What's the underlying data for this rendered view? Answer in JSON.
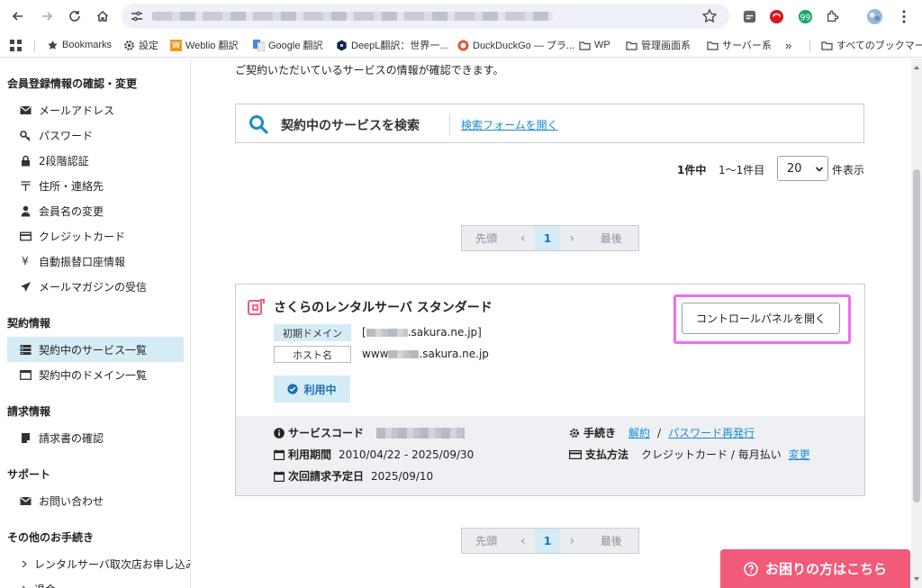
{
  "browser": {
    "back_icon": "back-arrow-icon",
    "bookmarks": [
      {
        "label": "Bookmarks",
        "icon": "star-icon"
      },
      {
        "label": "設定",
        "icon": "gear-icon"
      },
      {
        "label": "Weblio 翻訳",
        "icon": "weblio-icon"
      },
      {
        "label": "Google 翻訳",
        "icon": "google-translate-icon"
      },
      {
        "label": "DeepL翻訳：世界一...",
        "icon": "deepl-icon"
      },
      {
        "label": "DuckDuckGo — プラ...",
        "icon": "duckduckgo-icon"
      },
      {
        "label": "WP",
        "icon": "folder-icon"
      },
      {
        "label": "管理画面系",
        "icon": "folder-icon"
      },
      {
        "label": "サーバー系",
        "icon": "folder-icon"
      },
      {
        "label": "»",
        "icon": "more-icon"
      },
      {
        "label": "すべてのブックマーク",
        "icon": "folder-icon"
      }
    ]
  },
  "sidebar": {
    "sections": [
      {
        "heading": "会員登録情報の確認・変更",
        "items": [
          {
            "label": "メールアドレス",
            "icon": "envelope-icon"
          },
          {
            "label": "パスワード",
            "icon": "key-icon"
          },
          {
            "label": "2段階認証",
            "icon": "lock-icon"
          },
          {
            "label": "住所・連絡先",
            "icon": "postal-mark-icon"
          },
          {
            "label": "会員名の変更",
            "icon": "user-icon"
          },
          {
            "label": "クレジットカード",
            "icon": "credit-card-icon"
          },
          {
            "label": "自動振替口座情報",
            "icon": "yen-icon"
          },
          {
            "label": "メールマガジンの受信",
            "icon": "paper-plane-icon"
          }
        ]
      },
      {
        "heading": "契約情報",
        "items": [
          {
            "label": "契約中のサービス一覧",
            "icon": "server-list-icon",
            "active": true
          },
          {
            "label": "契約中のドメイン一覧",
            "icon": "window-icon"
          }
        ]
      },
      {
        "heading": "請求情報",
        "items": [
          {
            "label": "請求書の確認",
            "icon": "invoice-icon"
          }
        ]
      },
      {
        "heading": "サポート",
        "items": [
          {
            "label": "お問い合わせ",
            "icon": "envelope-icon"
          }
        ]
      },
      {
        "heading": "その他のお手続き",
        "items": [
          {
            "label": "レンタルサーバ取次店お申し込み",
            "icon": "chevron-right-icon"
          },
          {
            "label": "退会",
            "icon": "chevron-right-icon"
          }
        ]
      }
    ]
  },
  "main": {
    "intro": "ご契約いただいているサービスの情報が確認できます。",
    "search": {
      "title": "契約中のサービスを検索",
      "open_link": "検索フォームを開く"
    },
    "results": {
      "total": "1件中",
      "range": "1〜1件目",
      "per_page": "20",
      "per_page_suffix": "件表示"
    },
    "pager": {
      "first": "先頭",
      "prev": "‹",
      "current": "1",
      "next": "›",
      "last": "最後"
    },
    "service": {
      "name": "さくらのレンタルサーバ スタンダード",
      "initial_domain_label": "初期ドメイン",
      "initial_domain_prefix": "[",
      "initial_domain_value": ".sakura.ne.jp]",
      "host_label": "ホスト名",
      "host_prefix": "www",
      "host_value": ".sakura.ne.jp",
      "status": "利用中",
      "control_panel_button": "コントロールパネルを開く",
      "service_code_label": "サービスコード",
      "period_label": "利用期間",
      "period_value": "2010/04/22 - 2025/09/30",
      "next_billing_label": "次回請求予定日",
      "next_billing_value": "2025/09/10",
      "procedures_label": "手続き",
      "cancel_link": "解約",
      "separator": "/",
      "password_reissue_link": "パスワード再発行",
      "payment_label": "支払方法",
      "payment_value": "クレジットカード / 毎月払い",
      "change_link": "変更"
    },
    "help_button": "お困りの方はこちら"
  },
  "colors": {
    "accent": "#1a8bd1",
    "active_bg": "#d5ecf7",
    "highlight": "#ef6df0",
    "help": "#f15a79"
  }
}
